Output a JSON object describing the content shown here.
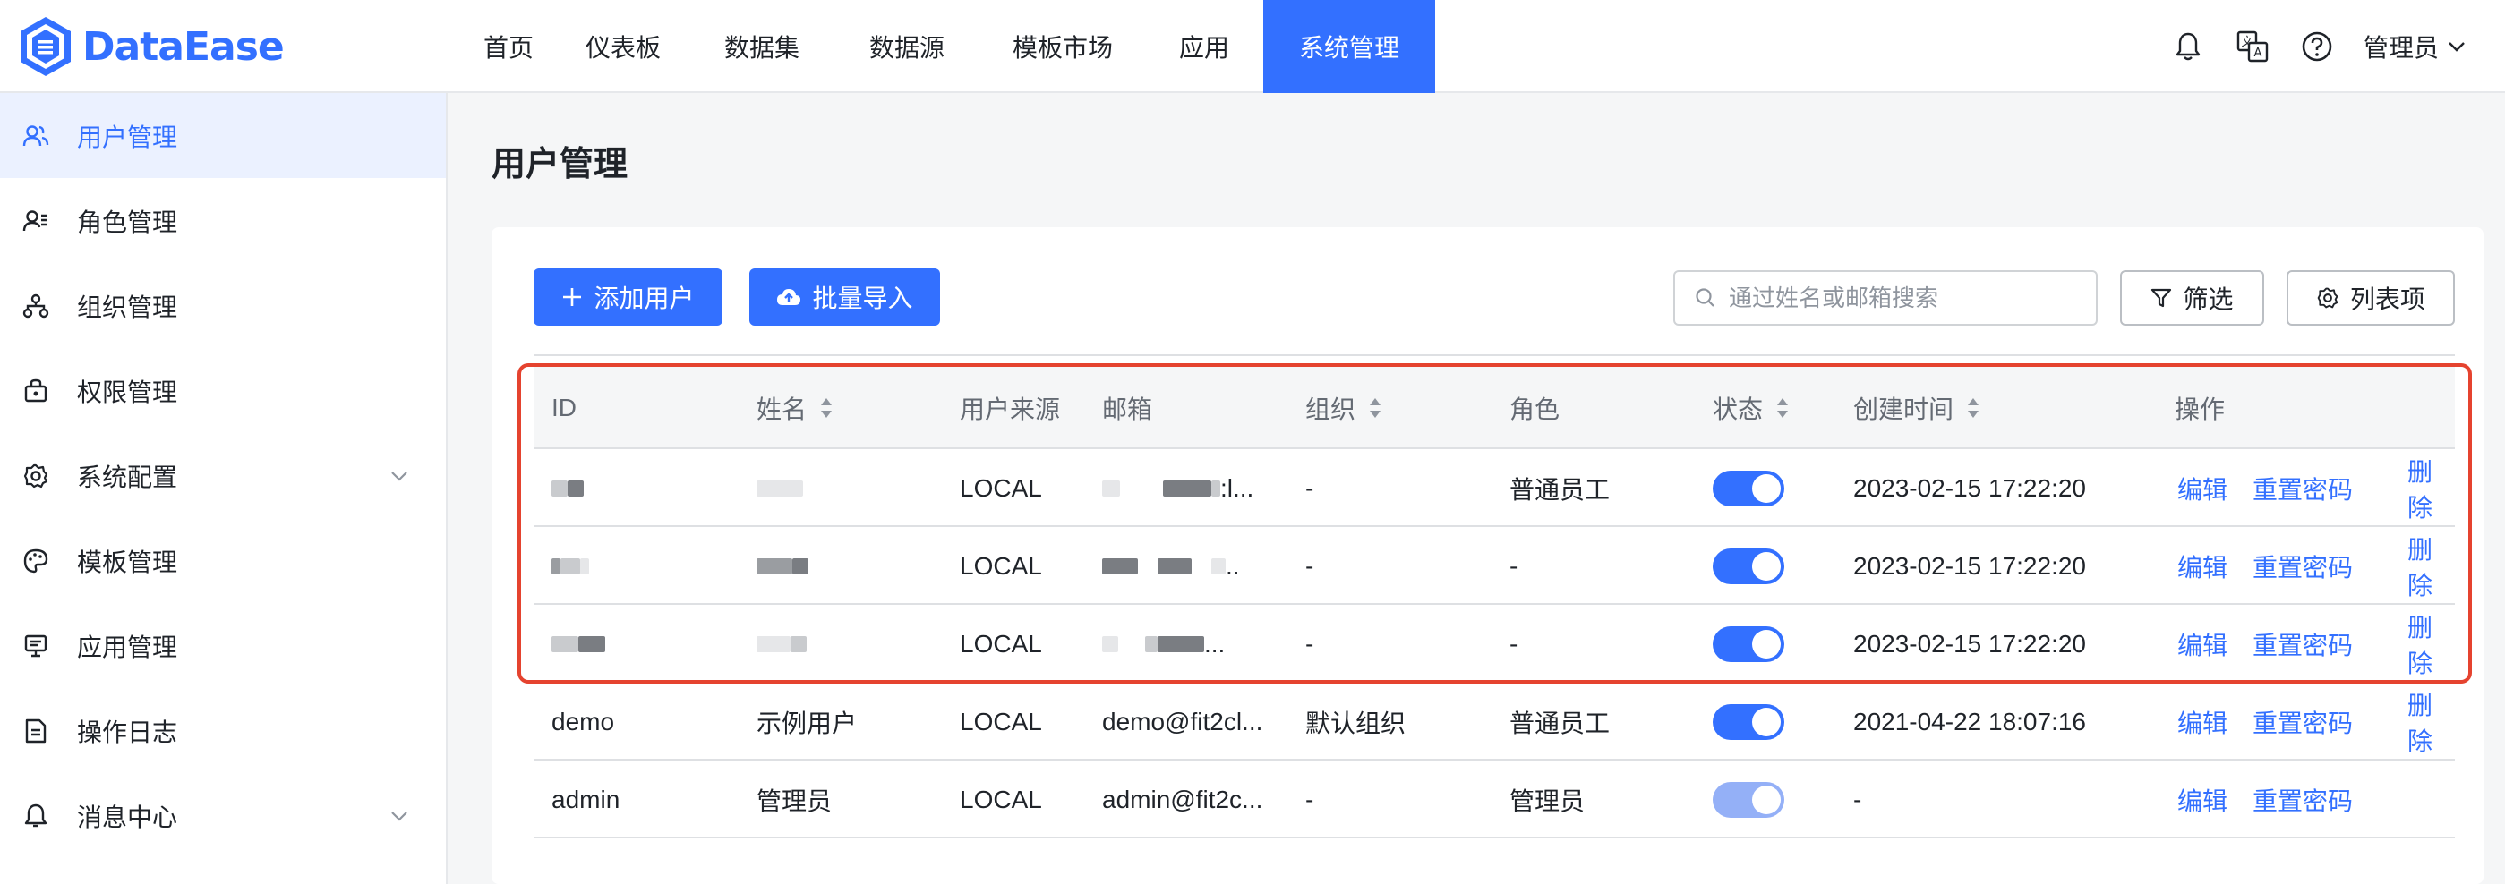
{
  "app": {
    "name": "DataEase"
  },
  "nav": {
    "items": [
      {
        "label": "首页",
        "active": false
      },
      {
        "label": "仪表板",
        "active": false
      },
      {
        "label": "数据集",
        "active": false
      },
      {
        "label": "数据源",
        "active": false
      },
      {
        "label": "模板市场",
        "active": false
      },
      {
        "label": "应用",
        "active": false
      },
      {
        "label": "系统管理",
        "active": true
      }
    ]
  },
  "header": {
    "user": "管理员",
    "icons": [
      "notification-bell-icon",
      "translate-icon",
      "help-icon"
    ]
  },
  "sidebar": {
    "items": [
      {
        "label": "用户管理",
        "icon": "users-icon",
        "active": true
      },
      {
        "label": "角色管理",
        "icon": "role-icon",
        "active": false
      },
      {
        "label": "组织管理",
        "icon": "org-icon",
        "active": false
      },
      {
        "label": "权限管理",
        "icon": "permission-icon",
        "active": false
      },
      {
        "label": "系统配置",
        "icon": "gear-icon",
        "active": false,
        "expandable": true
      },
      {
        "label": "模板管理",
        "icon": "palette-icon",
        "active": false
      },
      {
        "label": "应用管理",
        "icon": "monitor-icon",
        "active": false
      },
      {
        "label": "操作日志",
        "icon": "document-icon",
        "active": false
      },
      {
        "label": "消息中心",
        "icon": "bell-icon",
        "active": false,
        "expandable": true
      }
    ]
  },
  "page": {
    "title": "用户管理"
  },
  "toolbar": {
    "add_user": "添加用户",
    "batch_import": "批量导入",
    "search_placeholder": "通过姓名或邮箱搜索",
    "filter": "筛选",
    "columns": "列表项"
  },
  "table": {
    "headers": {
      "id": "ID",
      "name": "姓名",
      "source": "用户来源",
      "email": "邮箱",
      "org": "组织",
      "role": "角色",
      "status": "状态",
      "created": "创建时间",
      "actions": "操作"
    },
    "actions": {
      "edit": "编辑",
      "reset_password": "重置密码",
      "delete": "删除"
    },
    "rows": [
      {
        "id": "",
        "name": "",
        "source": "LOCAL",
        "email": ":l...",
        "org": "-",
        "role": "普通员工",
        "enabled": true,
        "created": "2023-02-15 17:22:20",
        "deletable": true,
        "redacted": true
      },
      {
        "id": "",
        "name": "",
        "source": "LOCAL",
        "email": "..",
        "org": "-",
        "role": "-",
        "enabled": true,
        "created": "2023-02-15 17:22:20",
        "deletable": true,
        "redacted": true
      },
      {
        "id": "",
        "name": "",
        "source": "LOCAL",
        "email": "...",
        "org": "-",
        "role": "-",
        "enabled": true,
        "created": "2023-02-15 17:22:20",
        "deletable": true,
        "redacted": true
      },
      {
        "id": "demo",
        "name": "示例用户",
        "source": "LOCAL",
        "email": "demo@fit2cl...",
        "org": "默认组织",
        "role": "普通员工",
        "enabled": true,
        "created": "2021-04-22 18:07:16",
        "deletable": true,
        "redacted": false
      },
      {
        "id": "admin",
        "name": "管理员",
        "source": "LOCAL",
        "email": "admin@fit2c...",
        "org": "-",
        "role": "管理员",
        "enabled": true,
        "toggle_disabled": true,
        "created": "-",
        "deletable": false,
        "redacted": false
      }
    ]
  },
  "colors": {
    "accent": "#3370ff",
    "highlight": "#e5432f",
    "active_bg": "#ebf1ff"
  }
}
